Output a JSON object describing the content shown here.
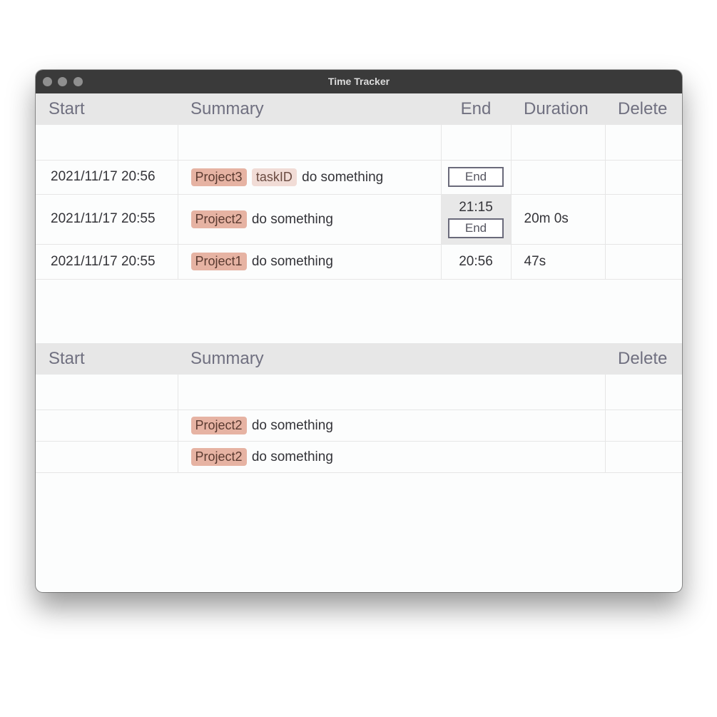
{
  "window": {
    "title": "Time Tracker"
  },
  "active_table": {
    "headers": {
      "start": "Start",
      "summary": "Summary",
      "end": "End",
      "duration": "Duration",
      "delete": "Delete"
    },
    "rows": [
      {
        "start": "2021/11/17 20:56",
        "tag": "Project3",
        "tag2": "taskID",
        "text": "do something",
        "end_button": "End",
        "duration": ""
      },
      {
        "start": "2021/11/17 20:55",
        "tag": "Project2",
        "text": "do something",
        "end_time": "21:15",
        "end_button": "End",
        "duration": "20m 0s"
      },
      {
        "start": "2021/11/17 20:55",
        "tag": "Project1",
        "text": "do something",
        "end_time": "20:56",
        "duration": "47s"
      }
    ]
  },
  "template_table": {
    "headers": {
      "start": "Start",
      "summary": "Summary",
      "delete": "Delete"
    },
    "rows": [
      {
        "tag": "Project2",
        "text": "do something"
      },
      {
        "tag": "Project2",
        "text": "do something"
      }
    ]
  },
  "colors": {
    "titlebar": "#3a3a3a",
    "header_bg": "#e7e7e7",
    "tag": "#e6b3a3",
    "tag_light": "#f1dcd6"
  }
}
